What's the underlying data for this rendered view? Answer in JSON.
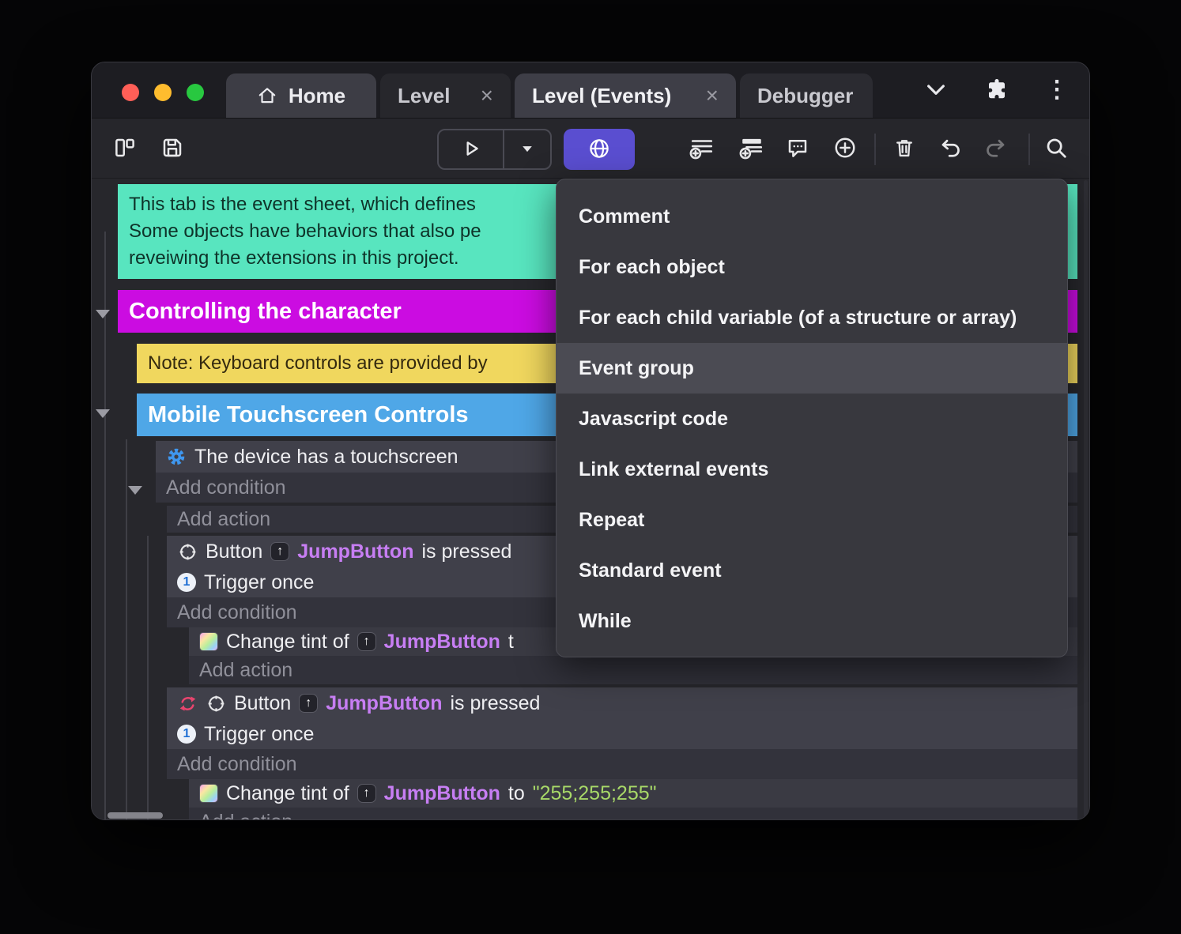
{
  "colors": {
    "accent_purple": "#5a4ed0",
    "comment_bg": "#58e5bf",
    "group_magenta": "#cb0ce1",
    "note_yellow": "#f0d75e",
    "group_blue": "#4fa7e7",
    "object_name": "#c77ef3",
    "string_value": "#a8d968",
    "menu_bg": "#38383e",
    "menu_highlight": "#4b4b53"
  },
  "glyphs": {
    "close": "×",
    "kebab": "⋮",
    "up_arrow": "↑",
    "one": "1"
  },
  "window": {
    "traffic_lights": [
      "#ff5f57",
      "#febc2e",
      "#28c840"
    ]
  },
  "titlebar": {
    "tabs": [
      {
        "label": "Home"
      },
      {
        "label": "Level"
      },
      {
        "label": "Level (Events)"
      },
      {
        "label": "Debugger"
      }
    ]
  },
  "sheet": {
    "comment": {
      "lines": [
        "This tab is the event sheet, which defines",
        "Some objects have behaviors that also pe",
        "reveiwing the extensions in this project."
      ]
    },
    "group1": "Controlling the character",
    "note": "Note: Keyboard controls are provided by",
    "group2": "Mobile Touchscreen Controls",
    "system_condition": "The device has a touchscreen",
    "labels": {
      "add_condition": "Add condition",
      "add_action": "Add action",
      "trigger_once": "Trigger once"
    },
    "button_event": {
      "object": "Button",
      "target": "JumpButton",
      "suffix": "is pressed"
    },
    "tint_action": {
      "prefix": "Change tint of",
      "target": "JumpButton",
      "cut_suffix": "t",
      "to": "to",
      "value": "\"255;255;255\""
    }
  },
  "context_menu": {
    "highlighted": "Event group",
    "items": [
      {
        "label": "Comment"
      },
      {
        "label": "For each object"
      },
      {
        "label": "For each child variable (of a structure or array)"
      },
      {
        "label": "Event group"
      },
      {
        "label": "Javascript code"
      },
      {
        "label": "Link external events"
      },
      {
        "label": "Repeat"
      },
      {
        "label": "Standard event"
      },
      {
        "label": "While"
      }
    ]
  }
}
